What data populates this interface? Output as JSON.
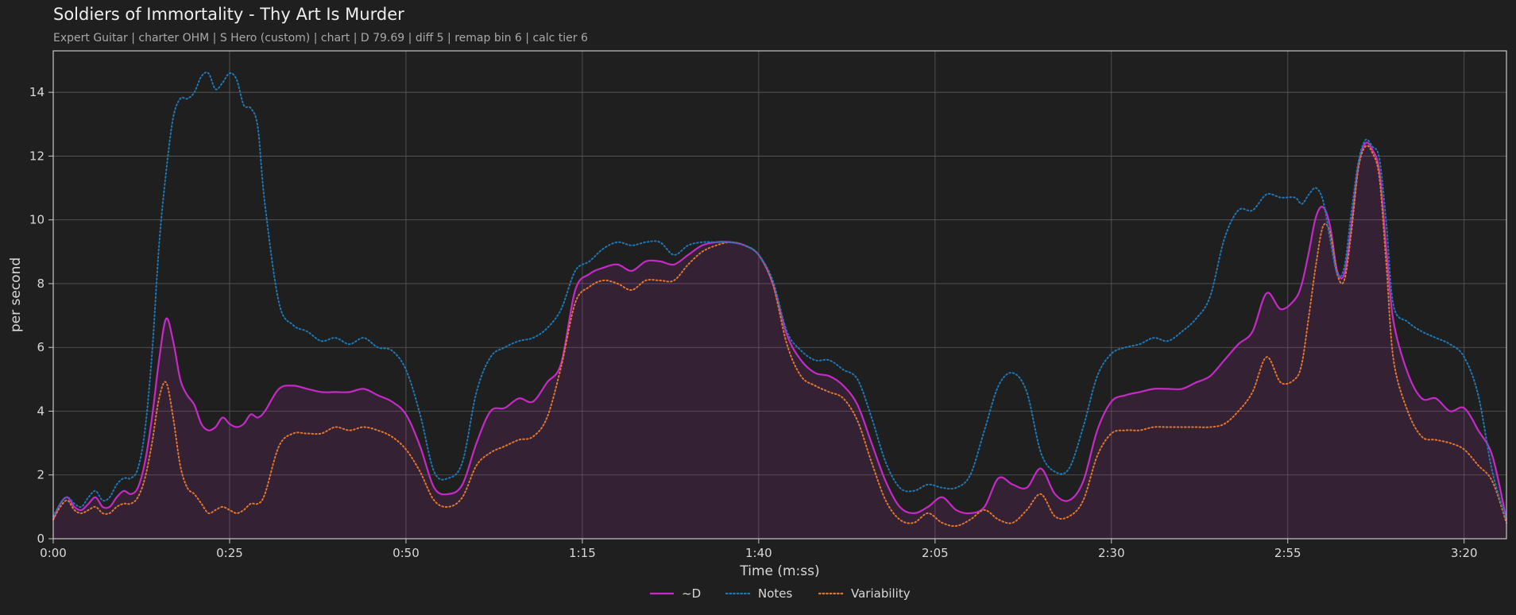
{
  "chart_data": {
    "type": "line",
    "title": "Soldiers of Immortality - Thy Art Is Murder",
    "subtitle": "Expert Guitar  |  charter OHM  |  S Hero (custom)  |  chart  |  D 79.69  |  diff 5  |  remap bin 6  |  calc tier 6",
    "xlabel": "Time (m:ss)",
    "ylabel": "per second",
    "xlim": [
      0,
      206
    ],
    "ylim": [
      0,
      15.3
    ],
    "grid": true,
    "legend_position": "bottom-center",
    "x_tick_values": [
      0,
      25,
      50,
      75,
      100,
      125,
      150,
      175,
      200
    ],
    "x_tick_labels": [
      "0:00",
      "0:25",
      "0:50",
      "1:15",
      "1:40",
      "2:05",
      "2:30",
      "2:55",
      "3:20"
    ],
    "y_tick_values": [
      0,
      2,
      4,
      6,
      8,
      10,
      12,
      14
    ],
    "y_tick_labels": [
      "0",
      "2",
      "4",
      "6",
      "8",
      "10",
      "12",
      "14"
    ],
    "x": [
      0,
      1,
      2,
      3,
      4,
      5,
      6,
      7,
      8,
      9,
      10,
      11,
      12,
      13,
      14,
      15,
      16,
      17,
      18,
      19,
      20,
      21,
      22,
      23,
      24,
      25,
      26,
      27,
      28,
      29,
      30,
      32,
      34,
      36,
      38,
      40,
      42,
      44,
      46,
      48,
      50,
      52,
      54,
      56,
      58,
      60,
      62,
      64,
      66,
      68,
      70,
      72,
      74,
      76,
      78,
      80,
      82,
      84,
      86,
      88,
      90,
      92,
      94,
      96,
      98,
      100,
      102,
      104,
      106,
      108,
      110,
      112,
      114,
      116,
      118,
      120,
      122,
      124,
      126,
      128,
      130,
      132,
      134,
      136,
      138,
      140,
      142,
      144,
      146,
      148,
      150,
      152,
      154,
      156,
      158,
      160,
      162,
      164,
      166,
      168,
      170,
      172,
      174,
      176,
      177,
      178,
      179,
      180,
      181,
      182,
      183,
      184,
      185,
      186,
      187,
      188,
      189,
      190,
      192,
      194,
      196,
      198,
      200,
      202,
      204,
      206
    ],
    "series": [
      {
        "name": "~D",
        "color": "#c42bc4",
        "style": "solid",
        "fill": true,
        "values": [
          0.6,
          1.1,
          1.3,
          1.0,
          0.9,
          1.1,
          1.3,
          1.0,
          1.0,
          1.3,
          1.5,
          1.4,
          1.6,
          2.4,
          3.8,
          5.6,
          6.9,
          6.2,
          5.0,
          4.5,
          4.2,
          3.6,
          3.4,
          3.5,
          3.8,
          3.6,
          3.5,
          3.6,
          3.9,
          3.8,
          4.0,
          4.7,
          4.8,
          4.7,
          4.6,
          4.6,
          4.6,
          4.7,
          4.5,
          4.3,
          3.9,
          2.9,
          1.6,
          1.4,
          1.7,
          3.0,
          4.0,
          4.1,
          4.4,
          4.3,
          4.9,
          5.5,
          7.8,
          8.3,
          8.5,
          8.6,
          8.4,
          8.7,
          8.7,
          8.6,
          8.9,
          9.2,
          9.3,
          9.3,
          9.2,
          8.9,
          8.0,
          6.4,
          5.6,
          5.2,
          5.1,
          4.8,
          4.2,
          3.0,
          1.8,
          1.0,
          0.8,
          1.0,
          1.3,
          0.9,
          0.8,
          1.0,
          1.9,
          1.7,
          1.6,
          2.2,
          1.4,
          1.2,
          1.8,
          3.4,
          4.3,
          4.5,
          4.6,
          4.7,
          4.7,
          4.7,
          4.9,
          5.1,
          5.6,
          6.1,
          6.5,
          7.7,
          7.2,
          7.5,
          8.0,
          9.0,
          10.1,
          10.4,
          9.8,
          8.4,
          8.3,
          9.8,
          11.7,
          12.4,
          12.2,
          11.5,
          9.0,
          6.8,
          5.2,
          4.4,
          4.4,
          4.0,
          4.1,
          3.4,
          2.6,
          0.6
        ]
      },
      {
        "name": "Notes",
        "color": "#1f77b4",
        "style": "dotted",
        "fill": false,
        "values": [
          0.7,
          1.1,
          1.3,
          1.1,
          1.0,
          1.3,
          1.5,
          1.2,
          1.3,
          1.7,
          1.9,
          1.9,
          2.2,
          3.4,
          5.8,
          9.2,
          11.5,
          13.2,
          13.8,
          13.8,
          14.0,
          14.5,
          14.6,
          14.1,
          14.3,
          14.6,
          14.4,
          13.6,
          13.5,
          12.9,
          10.5,
          7.4,
          6.7,
          6.5,
          6.2,
          6.3,
          6.1,
          6.3,
          6.0,
          5.9,
          5.3,
          3.9,
          2.1,
          1.9,
          2.4,
          4.6,
          5.7,
          6.0,
          6.2,
          6.3,
          6.6,
          7.2,
          8.4,
          8.7,
          9.1,
          9.3,
          9.2,
          9.3,
          9.3,
          8.9,
          9.2,
          9.3,
          9.3,
          9.3,
          9.2,
          8.9,
          8.1,
          6.5,
          5.9,
          5.6,
          5.6,
          5.3,
          5.0,
          3.8,
          2.4,
          1.6,
          1.5,
          1.7,
          1.6,
          1.6,
          2.0,
          3.4,
          4.8,
          5.2,
          4.6,
          2.7,
          2.1,
          2.2,
          3.5,
          5.1,
          5.8,
          6.0,
          6.1,
          6.3,
          6.2,
          6.5,
          6.9,
          7.6,
          9.4,
          10.3,
          10.3,
          10.8,
          10.7,
          10.7,
          10.5,
          10.8,
          11.0,
          10.6,
          9.4,
          8.3,
          8.5,
          10.2,
          11.8,
          12.5,
          12.3,
          11.9,
          9.8,
          7.3,
          6.8,
          6.5,
          6.3,
          6.1,
          5.7,
          4.5,
          2.1,
          0.6
        ]
      },
      {
        "name": "Variability",
        "color": "#e0762e",
        "style": "dotted",
        "fill": false,
        "values": [
          0.6,
          1.0,
          1.2,
          0.9,
          0.8,
          0.9,
          1.0,
          0.8,
          0.8,
          1.0,
          1.1,
          1.1,
          1.3,
          1.9,
          3.0,
          4.4,
          4.9,
          3.8,
          2.3,
          1.6,
          1.4,
          1.1,
          0.8,
          0.9,
          1.0,
          0.9,
          0.8,
          0.9,
          1.1,
          1.1,
          1.4,
          2.9,
          3.3,
          3.3,
          3.3,
          3.5,
          3.4,
          3.5,
          3.4,
          3.2,
          2.8,
          2.1,
          1.2,
          1.0,
          1.3,
          2.3,
          2.7,
          2.9,
          3.1,
          3.2,
          3.8,
          5.4,
          7.4,
          7.9,
          8.1,
          8.0,
          7.8,
          8.1,
          8.1,
          8.1,
          8.6,
          9.0,
          9.2,
          9.3,
          9.2,
          8.9,
          8.0,
          6.1,
          5.1,
          4.8,
          4.6,
          4.4,
          3.7,
          2.4,
          1.2,
          0.6,
          0.5,
          0.8,
          0.5,
          0.4,
          0.6,
          0.9,
          0.6,
          0.5,
          0.9,
          1.4,
          0.7,
          0.7,
          1.2,
          2.6,
          3.3,
          3.4,
          3.4,
          3.5,
          3.5,
          3.5,
          3.5,
          3.5,
          3.6,
          4.0,
          4.6,
          5.7,
          4.9,
          5.0,
          5.5,
          7.0,
          8.6,
          9.8,
          9.6,
          8.3,
          8.1,
          9.6,
          11.6,
          12.3,
          12.1,
          11.3,
          8.5,
          5.6,
          4.0,
          3.2,
          3.1,
          3.0,
          2.8,
          2.3,
          1.8,
          0.5
        ]
      }
    ]
  }
}
